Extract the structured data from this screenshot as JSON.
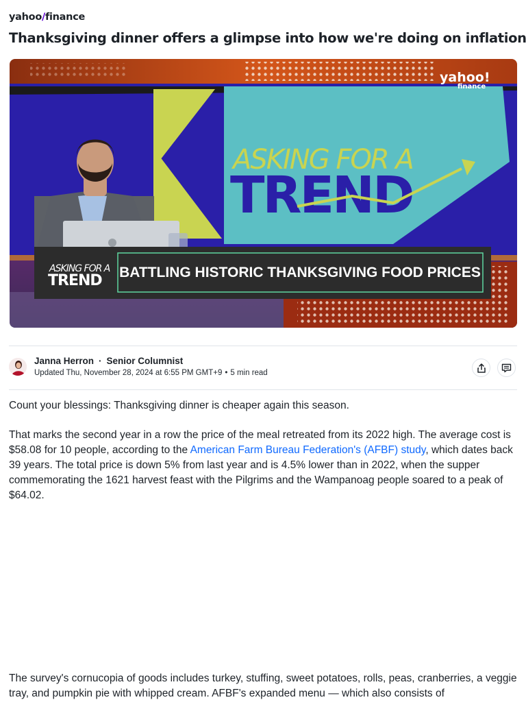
{
  "brand": {
    "name": "yahoo",
    "slash": "/",
    "section": "finance"
  },
  "article": {
    "headline": "Thanksgiving dinner offers a glimpse into how we're doing on inflation",
    "author": "Janna Herron",
    "author_title": "Senior Columnist",
    "updated": "Updated Thu, November 28, 2024 at 6:55 PM GMT+9",
    "read_time": "5 min read",
    "separator_dot": "·",
    "meta_separator": "•",
    "p1": "Count your blessings: Thanksgiving dinner is cheaper again this season.",
    "p2_before": "That marks the second year in a row the price of the meal retreated from its 2022 high. The average cost is $58.08 for 10 people, according to the ",
    "p2_link": "American Farm Bureau Federation's (AFBF) study",
    "p2_after": ", which dates back 39 years. The total price is down 5% from last year and is 4.5% lower than in 2022, when the supper commemorating the 1621 harvest feast with the Pilgrims and the Wampanoag people soared to a peak of $64.02.",
    "p3": "The survey's cornucopia of goods includes turkey, stuffing, sweet potatoes, rolls, peas, cranberries, a veggie tray, and pumpkin pie with whipped cream. AFBF's expanded menu — which also consists of"
  },
  "video": {
    "watermark_main": "yahoo!",
    "watermark_sub": "finance",
    "show_title_top": "ASKING FOR A",
    "show_title_main": "TREND",
    "lower_third_logo_top": "ASKING FOR A",
    "lower_third_logo_main": "TREND",
    "lower_third_text": "BATTLING HISTORIC THANKSGIVING FOOD PRICES"
  },
  "actions": {
    "share_icon": "share-icon",
    "comments_icon": "comment-icon"
  },
  "colors": {
    "brand_purple": "#6001d2",
    "link_blue": "#0f69ff",
    "studio_blue": "#2a1fa8",
    "teal": "#5cbfc4",
    "lime": "#c9d451"
  }
}
